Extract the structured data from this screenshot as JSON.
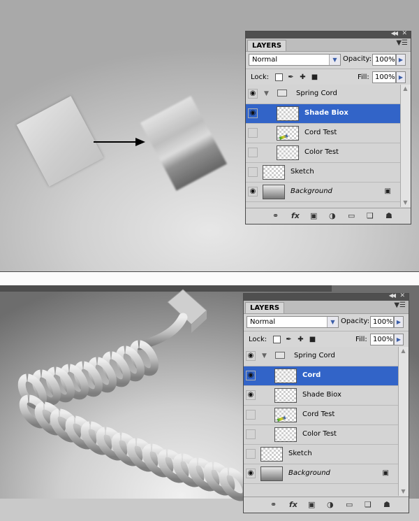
{
  "panels": [
    {
      "tab_label": "LAYERS",
      "blend_mode": "Normal",
      "opacity_label": "Opacity:",
      "opacity_value": "100%",
      "lock_label": "Lock:",
      "fill_label": "Fill:",
      "fill_value": "100%",
      "layers": [
        {
          "name": "Spring Cord",
          "kind": "group",
          "visible": true,
          "selected": false,
          "indent": false
        },
        {
          "name": "Shade Biox",
          "kind": "layer",
          "visible": true,
          "selected": true,
          "indent": true
        },
        {
          "name": "Cord Test",
          "kind": "layer-color",
          "visible": false,
          "selected": false,
          "indent": true
        },
        {
          "name": "Color Test",
          "kind": "layer",
          "visible": false,
          "selected": false,
          "indent": true
        },
        {
          "name": "Sketch",
          "kind": "layer",
          "visible": false,
          "selected": false,
          "indent": false
        },
        {
          "name": "Background",
          "kind": "background",
          "visible": true,
          "selected": false,
          "indent": false,
          "locked": true
        }
      ]
    },
    {
      "tab_label": "LAYERS",
      "blend_mode": "Normal",
      "opacity_label": "Opacity:",
      "opacity_value": "100%",
      "lock_label": "Lock:",
      "fill_label": "Fill:",
      "fill_value": "100%",
      "layers": [
        {
          "name": "Spring Cord",
          "kind": "group",
          "visible": true,
          "selected": false,
          "indent": false
        },
        {
          "name": "Cord",
          "kind": "layer",
          "visible": true,
          "selected": true,
          "indent": true
        },
        {
          "name": "Shade Biox",
          "kind": "layer",
          "visible": true,
          "selected": false,
          "indent": true
        },
        {
          "name": "Cord Test",
          "kind": "layer-color",
          "visible": false,
          "selected": false,
          "indent": true
        },
        {
          "name": "Color Test",
          "kind": "layer",
          "visible": false,
          "selected": false,
          "indent": true
        },
        {
          "name": "Sketch",
          "kind": "layer",
          "visible": false,
          "selected": false,
          "indent": false
        },
        {
          "name": "Background",
          "kind": "background",
          "visible": true,
          "selected": false,
          "indent": false,
          "locked": true
        }
      ]
    }
  ],
  "icons": {
    "footer": [
      "link-icon",
      "fx-icon",
      "mask-icon",
      "adjustment-icon",
      "folder-icon",
      "new-layer-icon",
      "trash-icon"
    ],
    "lock": [
      "lock-transparent-icon",
      "lock-brush-icon",
      "lock-move-icon",
      "lock-all-icon"
    ]
  },
  "colors": {
    "selection": "#3264c8",
    "panel_bg": "#d6d6d6",
    "title_bar": "#4f4f4f"
  }
}
